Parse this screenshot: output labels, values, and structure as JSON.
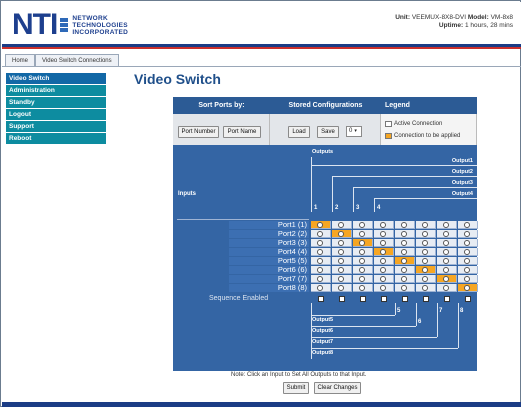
{
  "brand": {
    "logo_text": "NTI",
    "company_lines": [
      "NETWORK",
      "TECHNOLOGIES",
      "INCORPORATED"
    ]
  },
  "unit": {
    "unit_label": "Unit:",
    "unit_value": "VEEMUX-8X8-DVI",
    "model_label": "Model:",
    "model_value": "VM-8x8",
    "uptime_label": "Uptime:",
    "uptime_value": "1 hours, 28 mins"
  },
  "breadcrumb": [
    "Home",
    "Video Switch Connections"
  ],
  "sidebar": {
    "items": [
      {
        "label": "Video Switch",
        "active": true
      },
      {
        "label": "Administration",
        "active": false
      },
      {
        "label": "Standby",
        "active": false
      },
      {
        "label": "Logout",
        "active": false
      },
      {
        "label": "Support",
        "active": false
      },
      {
        "label": "Reboot",
        "active": false
      }
    ]
  },
  "page_title": "Video Switch",
  "headers": {
    "sort": "Sort Ports by:",
    "stored": "Stored Configurations",
    "legend": "Legend"
  },
  "buttons": {
    "port_number": "Port Number",
    "port_name": "Port Name",
    "load": "Load",
    "save": "Save",
    "submit": "Submit",
    "clear": "Clear Changes"
  },
  "config_select": {
    "value": "0"
  },
  "legend_items": [
    "Active Connection",
    "Connection to be applied"
  ],
  "matrix": {
    "inputs_label": "Inputs",
    "outputs_label": "Outputs",
    "output_labels_top": [
      "Output1",
      "Output2",
      "Output3",
      "Output4"
    ],
    "output_labels_bottom": [
      "Output5",
      "Output6",
      "Output7",
      "Output8"
    ],
    "col_numbers_top": [
      "1",
      "2",
      "3",
      "4"
    ],
    "col_numbers_bottom": [
      "5",
      "6",
      "7",
      "8"
    ],
    "rows": [
      {
        "label": "Port1 (1)",
        "selected_col": 1
      },
      {
        "label": "Port2 (2)",
        "selected_col": 2
      },
      {
        "label": "Port3 (3)",
        "selected_col": 3
      },
      {
        "label": "Port4 (4)",
        "selected_col": 4
      },
      {
        "label": "Port5 (5)",
        "selected_col": 5
      },
      {
        "label": "Port6 (6)",
        "selected_col": 6
      },
      {
        "label": "Port7 (7)",
        "selected_col": 7
      },
      {
        "label": "Port8 (8)",
        "selected_col": 8
      }
    ],
    "sequence_label": "Sequence Enabled"
  },
  "note": "Note: Click an Input to Set All Outputs to that Input.",
  "colors": {
    "nav": "#0d8ca0",
    "header": "#2c5b95",
    "matrix": "#3465a4",
    "selected": "#f6a623",
    "title": "#1f4f8a"
  }
}
